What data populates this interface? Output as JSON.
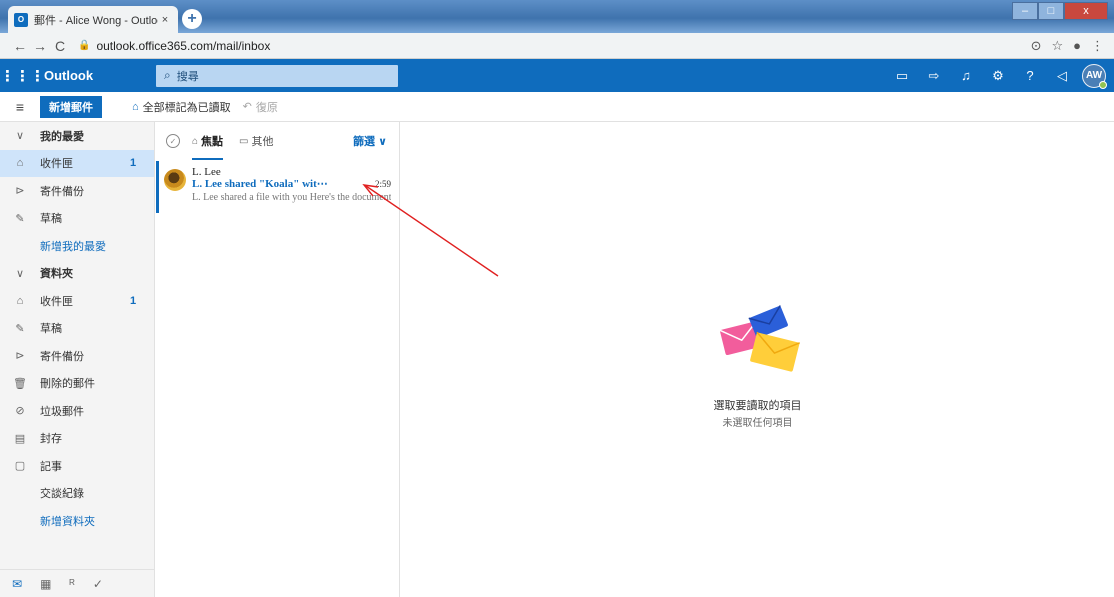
{
  "browser": {
    "tab_title": "郵件 - Alice Wong - Outlook",
    "tab_favicon": "O",
    "tab_close": "×",
    "new_tab": "+",
    "url": "outlook.office365.com/mail/inbox",
    "window_controls": [
      "–",
      "□",
      "x"
    ]
  },
  "header": {
    "brand": "Outlook",
    "search_placeholder": "搜尋",
    "avatar_initials": "AW",
    "icons": [
      "skype-icon",
      "todo-icon",
      "bell-icon",
      "gear-icon",
      "help-icon",
      "feedback-icon"
    ],
    "help_glyph": "?"
  },
  "toolbar": {
    "new_mail": "新增郵件",
    "mark_all_read": "全部標記為已讀取",
    "undo": "復原"
  },
  "sidebar": {
    "favorites_header": "我的最愛",
    "favorites": [
      {
        "label": "收件匣",
        "count": "1",
        "icon": "inbox-icon"
      },
      {
        "label": "寄件備份",
        "count": "",
        "icon": "send-icon"
      },
      {
        "label": "草稿",
        "count": "",
        "icon": "pencil-icon"
      }
    ],
    "add_favorite": "新增我的最愛",
    "folders_header": "資料夾",
    "folders": [
      {
        "label": "收件匣",
        "count": "1",
        "icon": "inbox-icon"
      },
      {
        "label": "草稿",
        "count": "",
        "icon": "pencil-icon"
      },
      {
        "label": "寄件備份",
        "count": "",
        "icon": "send-icon"
      },
      {
        "label": "刪除的郵件",
        "count": "",
        "icon": "trash-icon"
      },
      {
        "label": "垃圾郵件",
        "count": "",
        "icon": "block-icon"
      },
      {
        "label": "封存",
        "count": "",
        "icon": "archive-icon"
      },
      {
        "label": "記事",
        "count": "",
        "icon": "notes-icon"
      }
    ],
    "conversation_history": "交談紀錄",
    "new_folder": "新增資料夾",
    "bottom_icons": [
      "mail-icon",
      "calendar-icon",
      "people-icon",
      "attach-icon"
    ]
  },
  "message_list": {
    "pivots": [
      {
        "label": "焦點",
        "active": true
      },
      {
        "label": "其他",
        "active": false
      }
    ],
    "filter": "篩選",
    "messages": [
      {
        "from": "L. Lee",
        "subject": "L. Lee shared \"Koala\" wit⋯",
        "time": "2:59",
        "preview": "L. Lee shared a file with you Here's the document"
      }
    ]
  },
  "reading_pane": {
    "empty_title": "選取要讀取的項目",
    "empty_subtitle": "未選取任何項目"
  },
  "colors": {
    "accent": "#0f6cbd",
    "selected_bg": "#cfe4fa",
    "annotation_arrow": "#e02020"
  }
}
